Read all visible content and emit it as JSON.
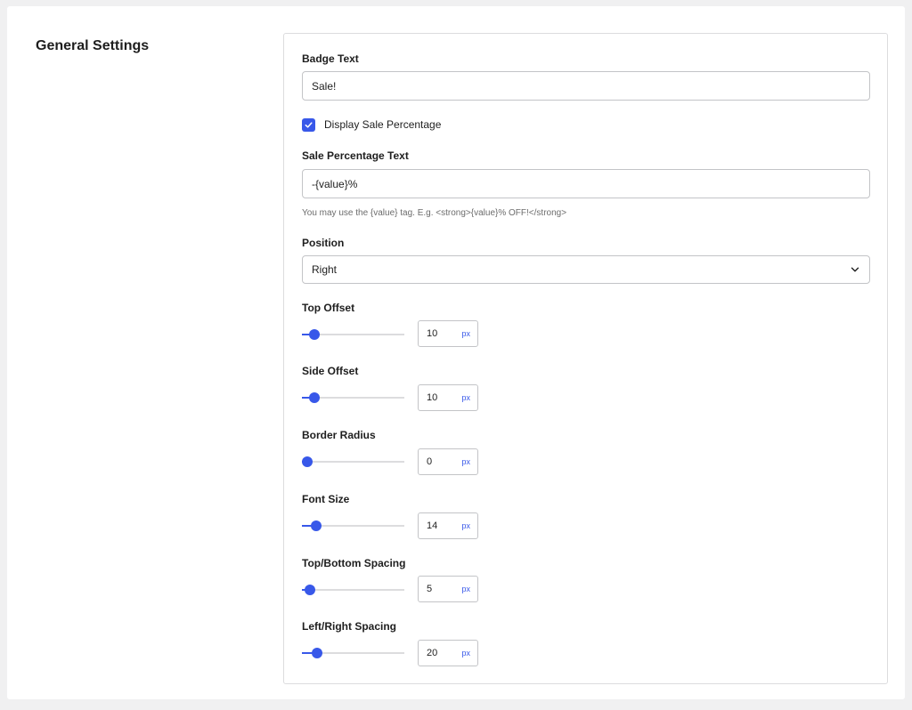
{
  "section_title": "General Settings",
  "badge_text": {
    "label": "Badge Text",
    "value": "Sale!"
  },
  "display_sale_percentage": {
    "label": "Display Sale Percentage",
    "checked": true
  },
  "sale_percentage_text": {
    "label": "Sale Percentage Text",
    "value": "-{value}%",
    "help": "You may use the {value} tag. E.g. <strong>{value}% OFF!</strong>"
  },
  "position": {
    "label": "Position",
    "value": "Right"
  },
  "sliders": [
    {
      "label": "Top Offset",
      "value": "10",
      "unit": "px",
      "level": 0.08
    },
    {
      "label": "Side Offset",
      "value": "10",
      "unit": "px",
      "level": 0.08
    },
    {
      "label": "Border Radius",
      "value": "0",
      "unit": "px",
      "level": 0.0
    },
    {
      "label": "Font Size",
      "value": "14",
      "unit": "px",
      "level": 0.1
    },
    {
      "label": "Top/Bottom Spacing",
      "value": "5",
      "unit": "px",
      "level": 0.03
    },
    {
      "label": "Left/Right Spacing",
      "value": "20",
      "unit": "px",
      "level": 0.11
    }
  ],
  "colors": {
    "accent": "#3858e9"
  }
}
